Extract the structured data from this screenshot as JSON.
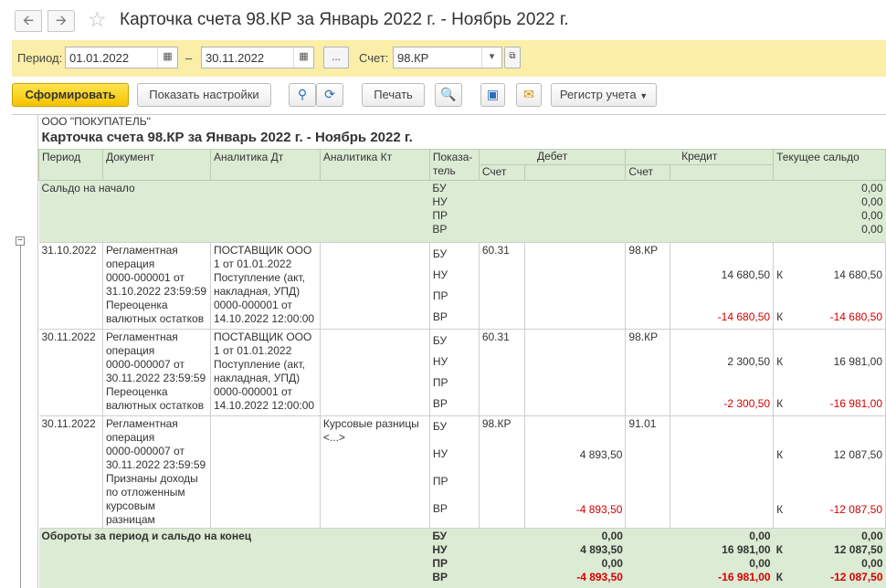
{
  "window": {
    "title": "Карточка счета 98.КР за Январь 2022 г. - Ноябрь 2022 г.",
    "back_icon": "arrow-left",
    "forward_icon": "arrow-right",
    "favorite_icon": "star"
  },
  "params": {
    "period_label": "Период:",
    "date_from": "01.01.2022",
    "dash": "–",
    "date_to": "30.11.2022",
    "ellipsis": "...",
    "account_label": "Счет:",
    "account_value": "98.КР"
  },
  "toolbar": {
    "generate": "Сформировать",
    "settings": "Показать настройки",
    "print": "Печать",
    "register": "Регистр учета"
  },
  "report": {
    "org": "ООО \"ПОКУПАТЕЛЬ\"",
    "title": "Карточка счета 98.КР за Январь 2022 г. - Ноябрь 2022 г.",
    "headers": {
      "period": "Период",
      "document": "Документ",
      "an_dt": "Аналитика Дт",
      "an_kt": "Аналитика Кт",
      "indicator": "Показа-\nтель",
      "debit": "Дебет",
      "credit": "Кредит",
      "balance": "Текущее сальдо",
      "account": "Счет"
    },
    "opening": {
      "label": "Сальдо на начало",
      "indicators": [
        "БУ",
        "НУ",
        "ПР",
        "ВР"
      ],
      "values": [
        "0,00",
        "0,00",
        "0,00",
        "0,00"
      ]
    },
    "rows": [
      {
        "period": "31.10.2022",
        "document": [
          "Регламентная",
          "операция",
          "0000-000001 от",
          "31.10.2022 23:59:59",
          "Переоценка",
          "валютных остатков"
        ],
        "an_dt": [
          "ПОСТАВЩИК ООО",
          "1 от 01.01.2022",
          "Поступление (акт,",
          "накладная, УПД)",
          "0000-000001 от",
          "14.10.2022 12:00:00"
        ],
        "an_kt": [],
        "indicators": [
          "БУ",
          "НУ",
          "ПР",
          "ВР"
        ],
        "debit_account": "60.31",
        "debit": [
          "",
          "",
          "",
          ""
        ],
        "credit_account": "98.КР",
        "credit": [
          "",
          "14 680,50",
          "",
          "-14 680,50"
        ],
        "dir": [
          "",
          "К",
          "",
          "К"
        ],
        "balance": [
          "",
          "14 680,50",
          "",
          "-14 680,50"
        ]
      },
      {
        "period": "30.11.2022",
        "document": [
          "Регламентная",
          "операция",
          "0000-000007 от",
          "30.11.2022 23:59:59",
          "Переоценка",
          "валютных остатков"
        ],
        "an_dt": [
          "ПОСТАВЩИК ООО",
          "1 от 01.01.2022",
          "Поступление (акт,",
          "накладная, УПД)",
          "0000-000001 от",
          "14.10.2022 12:00:00"
        ],
        "an_kt": [],
        "indicators": [
          "БУ",
          "НУ",
          "ПР",
          "ВР"
        ],
        "debit_account": "60.31",
        "debit": [
          "",
          "",
          "",
          ""
        ],
        "credit_account": "98.КР",
        "credit": [
          "",
          "2 300,50",
          "",
          "-2 300,50"
        ],
        "dir": [
          "",
          "К",
          "",
          "К"
        ],
        "balance": [
          "",
          "16 981,00",
          "",
          "-16 981,00"
        ]
      },
      {
        "period": "30.11.2022",
        "document": [
          "Регламентная",
          "операция",
          "0000-000007 от",
          "30.11.2022 23:59:59",
          "Признаны доходы",
          "по отложенным",
          "курсовым",
          "разницам"
        ],
        "an_dt": [],
        "an_kt": [
          "Курсовые разницы",
          "<...>"
        ],
        "indicators": [
          "БУ",
          "НУ",
          "ПР",
          "ВР"
        ],
        "debit_account": "98.КР",
        "debit": [
          "",
          "4 893,50",
          "",
          "-4 893,50"
        ],
        "credit_account": "91.01",
        "credit": [
          "",
          "",
          "",
          ""
        ],
        "dir": [
          "",
          "К",
          "",
          "К"
        ],
        "balance": [
          "",
          "12 087,50",
          "",
          "-12 087,50"
        ]
      }
    ],
    "totals": {
      "label": "Обороты за период и сальдо на конец",
      "indicators": [
        "БУ",
        "НУ",
        "ПР",
        "ВР"
      ],
      "debit": [
        "0,00",
        "4 893,50",
        "0,00",
        "-4 893,50"
      ],
      "credit": [
        "0,00",
        "16 981,00",
        "0,00",
        "-16 981,00"
      ],
      "dir": [
        "",
        "К",
        "",
        "К"
      ],
      "balance": [
        "0,00",
        "12 087,50",
        "0,00",
        "-12 087,50"
      ]
    }
  }
}
